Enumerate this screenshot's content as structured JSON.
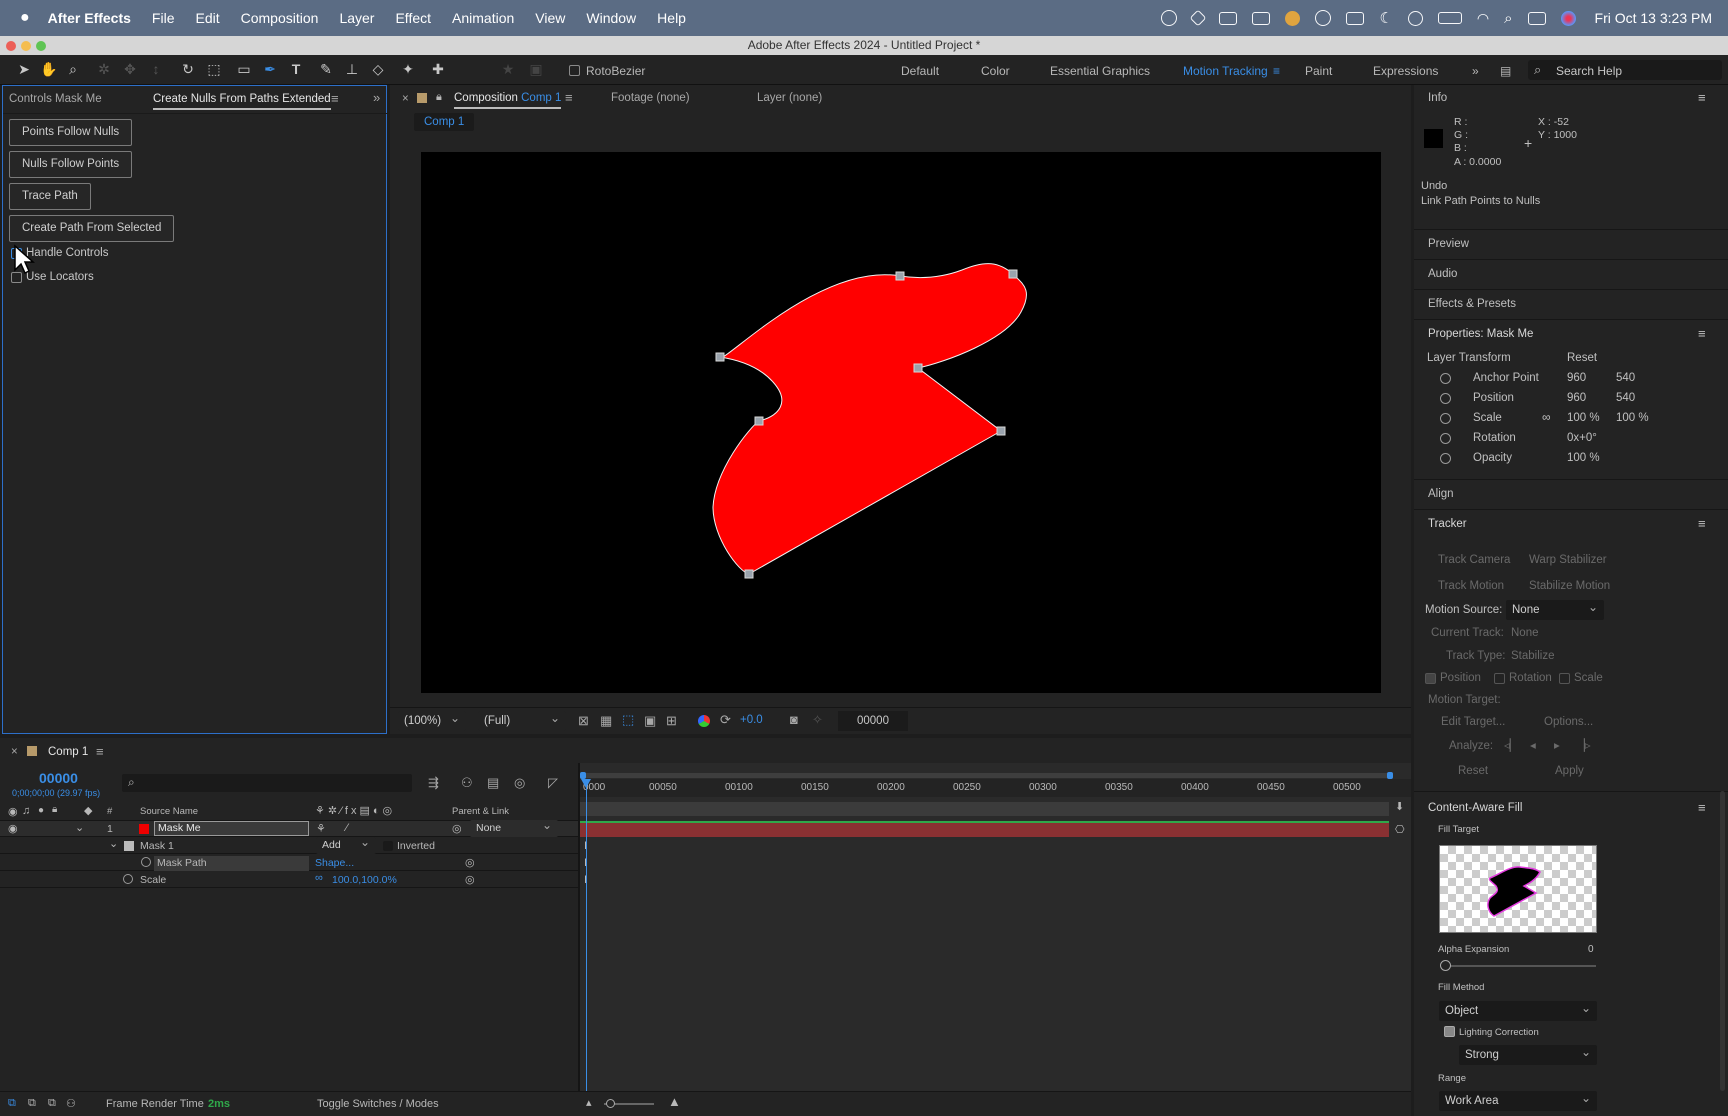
{
  "menubar": {
    "app_name": "After Effects",
    "items": [
      "File",
      "Edit",
      "Composition",
      "Layer",
      "Effect",
      "Animation",
      "View",
      "Window",
      "Help"
    ],
    "datetime": "Fri Oct 13  3:23 PM"
  },
  "titlebar": {
    "title": "Adobe After Effects 2024 - Untitled Project *"
  },
  "toolbar": {
    "rotobezier_label": "RotoBezier",
    "workspaces": [
      "Default",
      "Color",
      "Essential Graphics",
      "Motion Tracking",
      "Paint",
      "Expressions"
    ],
    "active_workspace": "Motion Tracking",
    "search_placeholder": "Search Help"
  },
  "left_panel": {
    "tab_inactive": "Controls Mask Me",
    "tab_active": "Create Nulls From Paths Extended",
    "buttons": [
      "Points Follow Nulls",
      "Nulls Follow Points",
      "Trace Path",
      "Create Path From Selected"
    ],
    "checkboxes": [
      "Handle Controls",
      "Use Locators"
    ]
  },
  "viewer": {
    "tab_composition": "Composition",
    "comp_name": "Comp 1",
    "tab_footage": "Footage (none)",
    "tab_layer": "Layer (none)",
    "breadcrumb": "Comp 1",
    "zoom": "(100%)",
    "resolution": "(Full)",
    "exposure": "+0.0",
    "timecode": "00000",
    "shape_color": "#ff0000"
  },
  "info_panel": {
    "title": "Info",
    "r_label": "R :",
    "g_label": "G :",
    "b_label": "B :",
    "a_label": "A :  0.0000",
    "x_label": "X : -52",
    "y_label": "Y : 1000",
    "undo_title": "Undo",
    "undo_action": "Link Path Points to Nulls"
  },
  "sections": {
    "preview": "Preview",
    "audio": "Audio",
    "effects": "Effects & Presets",
    "align": "Align",
    "tracker": "Tracker",
    "caf": "Content-Aware Fill"
  },
  "properties": {
    "title": "Properties: Mask Me",
    "group": "Layer Transform",
    "reset": "Reset",
    "rows": [
      {
        "name": "Anchor Point",
        "v1": "960",
        "v2": "540"
      },
      {
        "name": "Position",
        "v1": "960",
        "v2": "540"
      },
      {
        "name": "Scale",
        "v1": "100 %",
        "v2": "100 %"
      },
      {
        "name": "Rotation",
        "v1": "0x+0°",
        "v2": ""
      },
      {
        "name": "Opacity",
        "v1": "100 %",
        "v2": ""
      }
    ]
  },
  "tracker": {
    "track_camera": "Track Camera",
    "warp_stabilizer": "Warp Stabilizer",
    "track_motion": "Track Motion",
    "stabilize_motion": "Stabilize Motion",
    "motion_source_label": "Motion Source:",
    "motion_source_value": "None",
    "current_track_label": "Current Track:",
    "current_track_value": "None",
    "track_type_label": "Track Type:",
    "track_type_value": "Stabilize",
    "position": "Position",
    "rotation": "Rotation",
    "scale": "Scale",
    "motion_target": "Motion Target:",
    "edit_target": "Edit Target...",
    "options": "Options...",
    "analyze": "Analyze:",
    "reset": "Reset",
    "apply": "Apply"
  },
  "caf": {
    "fill_target": "Fill Target",
    "alpha_expansion": "Alpha Expansion",
    "alpha_value": "0",
    "fill_method": "Fill Method",
    "fill_method_value": "Object",
    "lighting_correction": "Lighting Correction",
    "lighting_value": "Strong",
    "range": "Range",
    "range_value": "Work Area"
  },
  "timeline": {
    "tab": "Comp 1",
    "timecode": "00000",
    "timecode_sub": "0;00;00;00 (29.97 fps)",
    "col_source": "Source Name",
    "col_num": "#",
    "col_parent": "Parent & Link",
    "layer_num": "1",
    "layer_name": "Mask Me",
    "layer_parent": "None",
    "mask_name": "Mask 1",
    "mask_mode": "Add",
    "mask_inverted": "Inverted",
    "mask_path": "Mask Path",
    "mask_path_value": "Shape...",
    "scale_label": "Scale",
    "scale_value": "100.0,100.0%",
    "ruler": [
      "00050",
      "00100",
      "00150",
      "00200",
      "00250",
      "00300",
      "00350",
      "00400",
      "00450",
      "00500"
    ],
    "ruler_start": "0000",
    "frame_render_label": "Frame Render Time",
    "frame_render_value": "2ms",
    "toggle_label": "Toggle Switches / Modes"
  }
}
